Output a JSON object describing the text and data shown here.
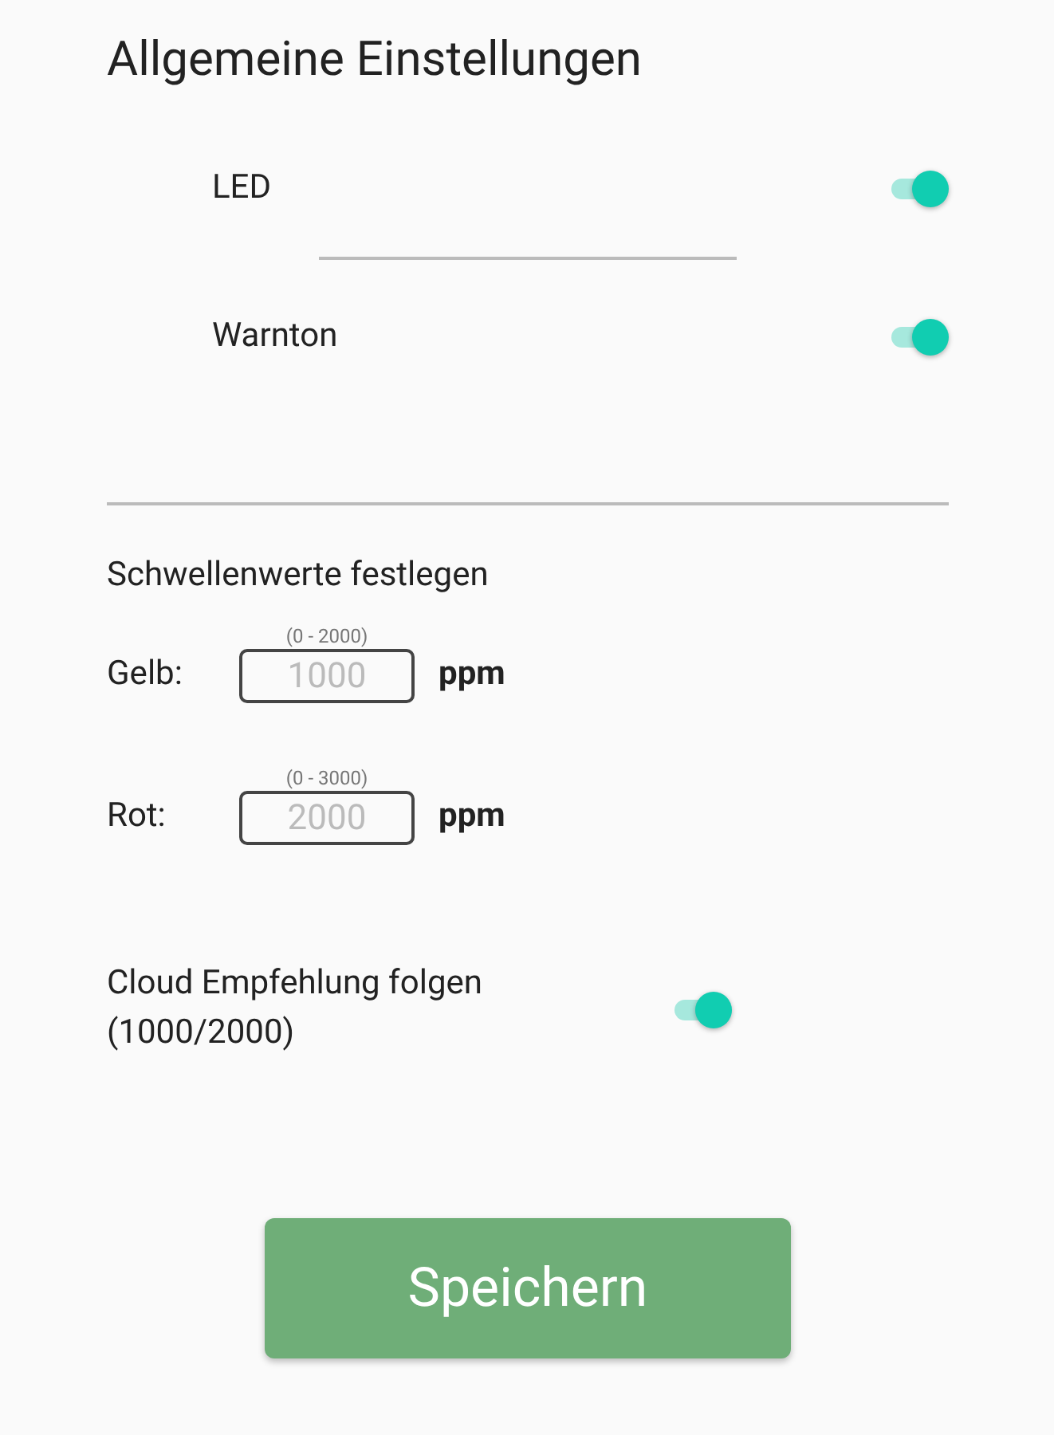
{
  "title": "Allgemeine Einstellungen",
  "toggles": [
    {
      "label": "LED",
      "on": true
    },
    {
      "label": "Warnton",
      "on": true
    }
  ],
  "thresholds": {
    "heading": "Schwellenwerte festlegen",
    "rows": [
      {
        "label": "Gelb:",
        "range": "(0 - 2000)",
        "placeholder": "1000",
        "unit": "ppm"
      },
      {
        "label": "Rot:",
        "range": "(0 - 3000)",
        "placeholder": "2000",
        "unit": "ppm"
      }
    ]
  },
  "cloud": {
    "label": "Cloud Empfehlung folgen\n(1000/2000)",
    "on": true
  },
  "save_button": "Speichern"
}
